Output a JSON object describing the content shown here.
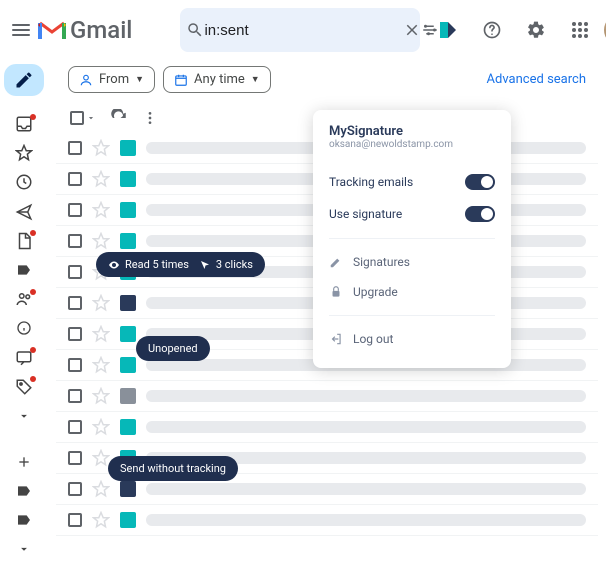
{
  "header": {
    "logo_text": "Gmail",
    "search_value": "in:sent"
  },
  "filters": {
    "from_label": "From",
    "anytime_label": "Any time",
    "adv_search": "Advanced search"
  },
  "popup": {
    "title": "MySignature",
    "email": "oksana@newoldstamp.com",
    "tracking": "Tracking emails",
    "use_sig": "Use signature",
    "signatures": "Signatures",
    "upgrade": "Upgrade",
    "logout": "Log out"
  },
  "tooltips": {
    "read_times": "Read 5 times",
    "clicks": "3 clicks",
    "unopened": "Unopened",
    "no_track": "Send without tracking"
  },
  "rows": [
    {
      "track": "teal"
    },
    {
      "track": "teal"
    },
    {
      "track": "teal"
    },
    {
      "track": "teal"
    },
    {
      "track": "teal"
    },
    {
      "track": "navy"
    },
    {
      "track": "teal"
    },
    {
      "track": "teal"
    },
    {
      "track": "gray"
    },
    {
      "track": "teal"
    },
    {
      "track": "teal"
    },
    {
      "track": "navy"
    },
    {
      "track": "teal"
    }
  ]
}
